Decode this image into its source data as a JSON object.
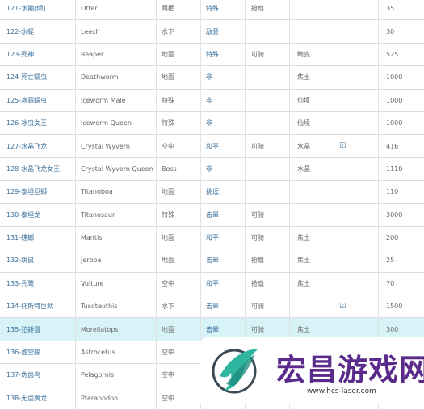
{
  "rows": [
    {
      "id": "121-水獭[倾]",
      "name": "Otter",
      "habitat": "两栖",
      "temper": "特殊",
      "tame": "抢扇",
      "food": "",
      "mount": "",
      "speed": "35"
    },
    {
      "id": "122-水蛭",
      "name": "Leech",
      "habitat": "水下",
      "temper": "敌意",
      "tame": "",
      "food": "",
      "mount": "",
      "speed": "30"
    },
    {
      "id": "123-死神",
      "name": "Reaper",
      "habitat": "地面",
      "temper": "特殊",
      "tame": "可骑",
      "food": "畸变",
      "mount": "",
      "speed": "525"
    },
    {
      "id": "124-死亡蠕虫",
      "name": "Deathworm",
      "habitat": "地面",
      "temper": "非",
      "tame": "",
      "food": "焦土",
      "mount": "",
      "speed": "1000"
    },
    {
      "id": "125-冰霜蠕虫",
      "name": "Iceworm Male",
      "habitat": "特殊",
      "temper": "非",
      "tame": "",
      "food": "仙境",
      "mount": "",
      "speed": "1000"
    },
    {
      "id": "126-冰虫女王",
      "name": "Iceworm Queen",
      "habitat": "特殊",
      "temper": "非",
      "tame": "",
      "food": "仙境",
      "mount": "",
      "speed": "1000"
    },
    {
      "id": "127-水晶飞龙",
      "name": "Crystal Wyvern",
      "habitat": "空中",
      "temper": "和平",
      "tame": "可骑",
      "food": "水晶",
      "mount": "☑",
      "speed": "416"
    },
    {
      "id": "128-水晶飞龙女王",
      "name": "Crystal Wyvern Queen",
      "habitat": "Boss",
      "temper": "非",
      "tame": "",
      "food": "水晶",
      "mount": "",
      "speed": "1110"
    },
    {
      "id": "129-泰坦巨蟒",
      "name": "Titanoboa",
      "habitat": "地面",
      "temper": "挑逗",
      "tame": "",
      "food": "",
      "mount": "",
      "speed": "110"
    },
    {
      "id": "130-泰坦龙",
      "name": "Titanosaur",
      "habitat": "特殊",
      "temper": "击晕",
      "tame": "可骑",
      "food": "",
      "mount": "",
      "speed": "3000"
    },
    {
      "id": "131-螳螂",
      "name": "Mantis",
      "habitat": "地面",
      "temper": "和平",
      "tame": "可骑",
      "food": "焦土",
      "mount": "",
      "speed": "200"
    },
    {
      "id": "132-跳鼠",
      "name": "Jerboa",
      "habitat": "地面",
      "temper": "击晕",
      "tame": "抢扇",
      "food": "焦土",
      "mount": "",
      "speed": "25"
    },
    {
      "id": "133-秃鹫",
      "name": "Vulture",
      "habitat": "空中",
      "temper": "和平",
      "tame": "抢扇",
      "food": "焦土",
      "mount": "",
      "speed": "70"
    },
    {
      "id": "134-托斯特巨鱿",
      "name": "Tusoteuthis",
      "habitat": "水下",
      "temper": "击晕",
      "tame": "可骑",
      "food": "",
      "mount": "☑",
      "speed": "1500"
    },
    {
      "id": "135-犯錘督",
      "name": "Morellatops",
      "habitat": "地面",
      "temper": "击晕",
      "tame": "可骑",
      "food": "焦土",
      "mount": "",
      "speed": "300"
    },
    {
      "id": "136-虚空鲸",
      "name": "Astrocetus",
      "habitat": "空中",
      "temper": "",
      "tame": "",
      "food": "",
      "mount": "",
      "speed": ""
    },
    {
      "id": "137-伪齿鸟",
      "name": "Pelagornis",
      "habitat": "空中",
      "temper": "",
      "tame": "",
      "food": "",
      "mount": "",
      "speed": ""
    },
    {
      "id": "138-无齿翼龙",
      "name": "Pteranodon",
      "habitat": "空中",
      "temper": "",
      "tame": "",
      "food": "",
      "mount": "",
      "speed": ""
    }
  ],
  "highlight_row": 14,
  "watermark": {
    "title": "宏昌游戏网",
    "url": "www.hcs-laser.com"
  },
  "colors": {
    "link": "#3a6f9a",
    "highlight": "#d8f3f7",
    "border": "#dcdcdc",
    "watermark_title": "#5b2b8c"
  }
}
